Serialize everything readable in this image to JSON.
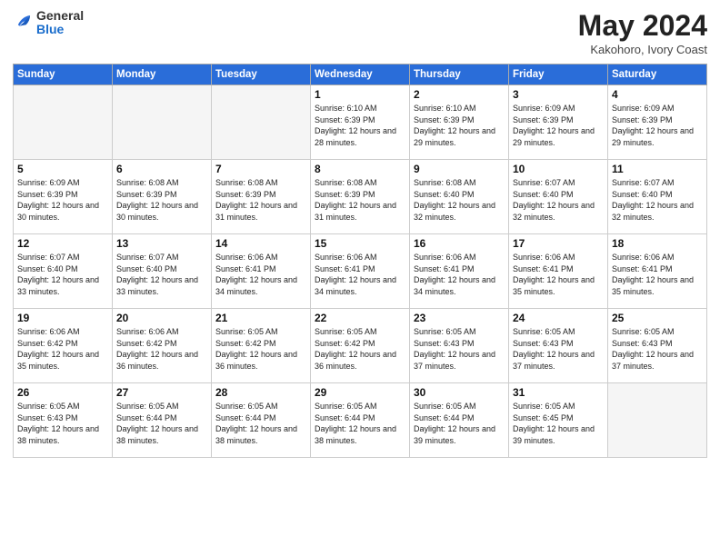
{
  "header": {
    "logo_general": "General",
    "logo_blue": "Blue",
    "title": "May 2024",
    "location": "Kakohoro, Ivory Coast"
  },
  "weekdays": [
    "Sunday",
    "Monday",
    "Tuesday",
    "Wednesday",
    "Thursday",
    "Friday",
    "Saturday"
  ],
  "weeks": [
    [
      {
        "day": "",
        "info": ""
      },
      {
        "day": "",
        "info": ""
      },
      {
        "day": "",
        "info": ""
      },
      {
        "day": "1",
        "info": "Sunrise: 6:10 AM\nSunset: 6:39 PM\nDaylight: 12 hours\nand 28 minutes."
      },
      {
        "day": "2",
        "info": "Sunrise: 6:10 AM\nSunset: 6:39 PM\nDaylight: 12 hours\nand 29 minutes."
      },
      {
        "day": "3",
        "info": "Sunrise: 6:09 AM\nSunset: 6:39 PM\nDaylight: 12 hours\nand 29 minutes."
      },
      {
        "day": "4",
        "info": "Sunrise: 6:09 AM\nSunset: 6:39 PM\nDaylight: 12 hours\nand 29 minutes."
      }
    ],
    [
      {
        "day": "5",
        "info": "Sunrise: 6:09 AM\nSunset: 6:39 PM\nDaylight: 12 hours\nand 30 minutes."
      },
      {
        "day": "6",
        "info": "Sunrise: 6:08 AM\nSunset: 6:39 PM\nDaylight: 12 hours\nand 30 minutes."
      },
      {
        "day": "7",
        "info": "Sunrise: 6:08 AM\nSunset: 6:39 PM\nDaylight: 12 hours\nand 31 minutes."
      },
      {
        "day": "8",
        "info": "Sunrise: 6:08 AM\nSunset: 6:39 PM\nDaylight: 12 hours\nand 31 minutes."
      },
      {
        "day": "9",
        "info": "Sunrise: 6:08 AM\nSunset: 6:40 PM\nDaylight: 12 hours\nand 32 minutes."
      },
      {
        "day": "10",
        "info": "Sunrise: 6:07 AM\nSunset: 6:40 PM\nDaylight: 12 hours\nand 32 minutes."
      },
      {
        "day": "11",
        "info": "Sunrise: 6:07 AM\nSunset: 6:40 PM\nDaylight: 12 hours\nand 32 minutes."
      }
    ],
    [
      {
        "day": "12",
        "info": "Sunrise: 6:07 AM\nSunset: 6:40 PM\nDaylight: 12 hours\nand 33 minutes."
      },
      {
        "day": "13",
        "info": "Sunrise: 6:07 AM\nSunset: 6:40 PM\nDaylight: 12 hours\nand 33 minutes."
      },
      {
        "day": "14",
        "info": "Sunrise: 6:06 AM\nSunset: 6:41 PM\nDaylight: 12 hours\nand 34 minutes."
      },
      {
        "day": "15",
        "info": "Sunrise: 6:06 AM\nSunset: 6:41 PM\nDaylight: 12 hours\nand 34 minutes."
      },
      {
        "day": "16",
        "info": "Sunrise: 6:06 AM\nSunset: 6:41 PM\nDaylight: 12 hours\nand 34 minutes."
      },
      {
        "day": "17",
        "info": "Sunrise: 6:06 AM\nSunset: 6:41 PM\nDaylight: 12 hours\nand 35 minutes."
      },
      {
        "day": "18",
        "info": "Sunrise: 6:06 AM\nSunset: 6:41 PM\nDaylight: 12 hours\nand 35 minutes."
      }
    ],
    [
      {
        "day": "19",
        "info": "Sunrise: 6:06 AM\nSunset: 6:42 PM\nDaylight: 12 hours\nand 35 minutes."
      },
      {
        "day": "20",
        "info": "Sunrise: 6:06 AM\nSunset: 6:42 PM\nDaylight: 12 hours\nand 36 minutes."
      },
      {
        "day": "21",
        "info": "Sunrise: 6:05 AM\nSunset: 6:42 PM\nDaylight: 12 hours\nand 36 minutes."
      },
      {
        "day": "22",
        "info": "Sunrise: 6:05 AM\nSunset: 6:42 PM\nDaylight: 12 hours\nand 36 minutes."
      },
      {
        "day": "23",
        "info": "Sunrise: 6:05 AM\nSunset: 6:43 PM\nDaylight: 12 hours\nand 37 minutes."
      },
      {
        "day": "24",
        "info": "Sunrise: 6:05 AM\nSunset: 6:43 PM\nDaylight: 12 hours\nand 37 minutes."
      },
      {
        "day": "25",
        "info": "Sunrise: 6:05 AM\nSunset: 6:43 PM\nDaylight: 12 hours\nand 37 minutes."
      }
    ],
    [
      {
        "day": "26",
        "info": "Sunrise: 6:05 AM\nSunset: 6:43 PM\nDaylight: 12 hours\nand 38 minutes."
      },
      {
        "day": "27",
        "info": "Sunrise: 6:05 AM\nSunset: 6:44 PM\nDaylight: 12 hours\nand 38 minutes."
      },
      {
        "day": "28",
        "info": "Sunrise: 6:05 AM\nSunset: 6:44 PM\nDaylight: 12 hours\nand 38 minutes."
      },
      {
        "day": "29",
        "info": "Sunrise: 6:05 AM\nSunset: 6:44 PM\nDaylight: 12 hours\nand 38 minutes."
      },
      {
        "day": "30",
        "info": "Sunrise: 6:05 AM\nSunset: 6:44 PM\nDaylight: 12 hours\nand 39 minutes."
      },
      {
        "day": "31",
        "info": "Sunrise: 6:05 AM\nSunset: 6:45 PM\nDaylight: 12 hours\nand 39 minutes."
      },
      {
        "day": "",
        "info": ""
      }
    ]
  ]
}
